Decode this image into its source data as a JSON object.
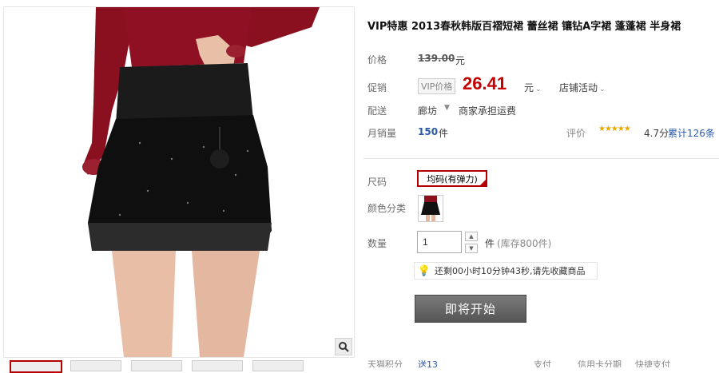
{
  "product": {
    "title": "VIP特惠 2013春秋韩版百褶短裙 蕾丝裙 镶钻A字裙 蓬蓬裙 半身裙"
  },
  "price": {
    "label": "价格",
    "original": "139.00",
    "currency": "元"
  },
  "promo": {
    "label": "促销",
    "tag": "VIP价格",
    "price": "26.41",
    "currency": "元",
    "store_activity": "店铺活动"
  },
  "delivery": {
    "label": "配送",
    "city": "廊坊",
    "shipping": "商家承担运费"
  },
  "sales": {
    "label": "月销量",
    "value": "150",
    "unit": "件",
    "rating_label": "评价",
    "stars": "★★★★★",
    "score": "4.7分",
    "count": "累计126条"
  },
  "size": {
    "label": "尺码",
    "option": "均码(有弹力)"
  },
  "color": {
    "label": "颜色分类"
  },
  "quantity": {
    "label": "数量",
    "value": "1",
    "unit": "件",
    "stock": "(库存800件)"
  },
  "notice": {
    "icon": "lightbulb-icon",
    "text": "还剩00小时10分钟43秒,请先收藏商品"
  },
  "cta": {
    "label": "即将开始"
  },
  "bottom": {
    "points_label": "天猫积分",
    "points_value": "送13",
    "pay_label": "支付",
    "credit": "信用卡分期",
    "pay2": "快捷支付"
  },
  "colors": {
    "accent_red": "#c40000",
    "selected_border": "#b40000",
    "link_blue": "#285aab",
    "button_gray": "#666666"
  }
}
